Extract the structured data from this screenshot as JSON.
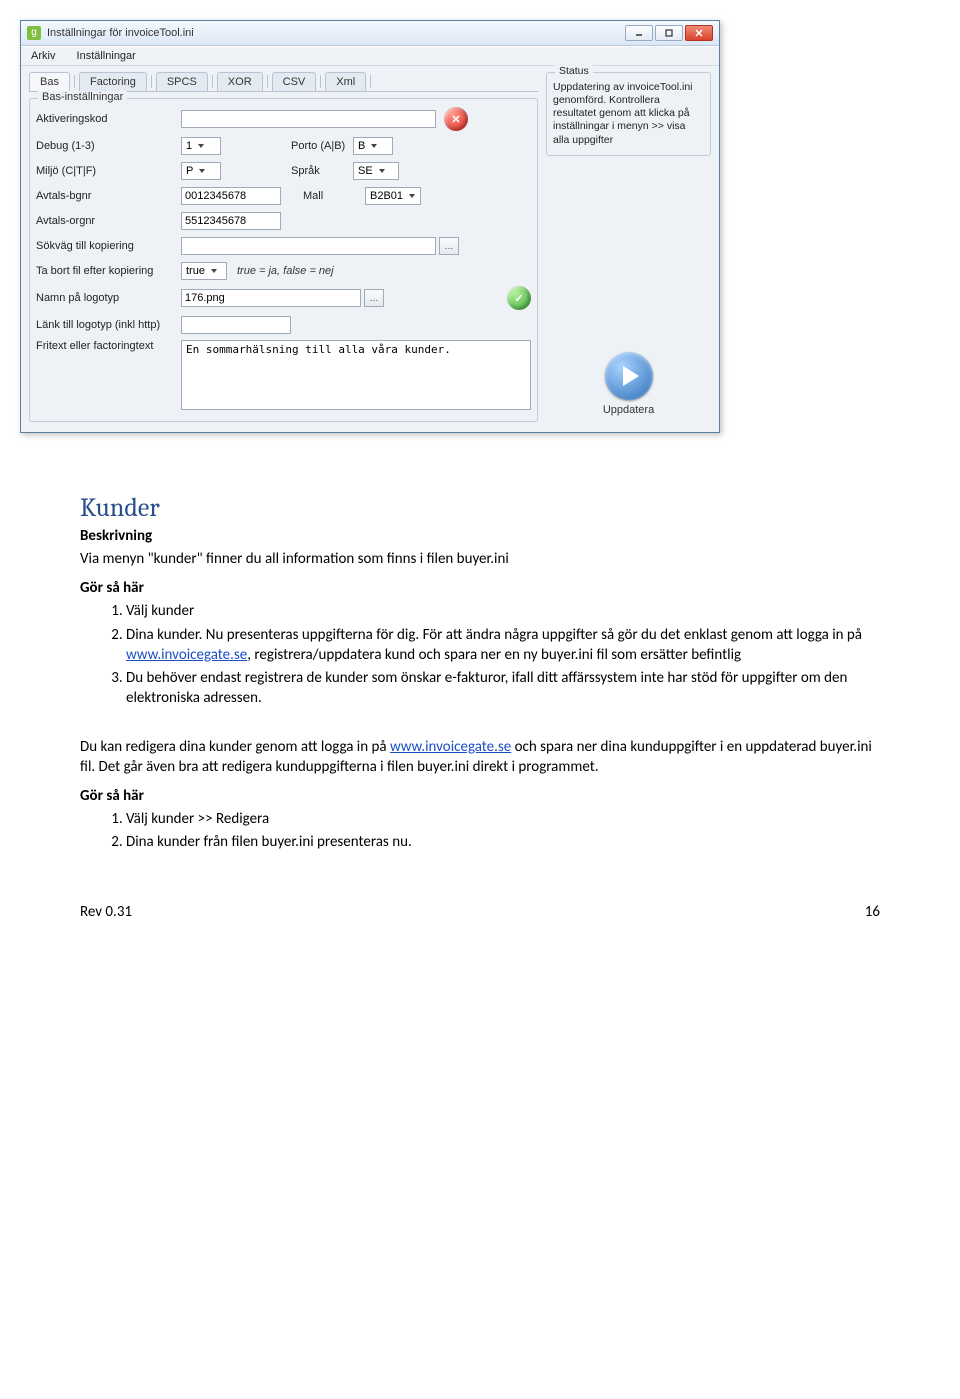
{
  "window": {
    "title": "Inställningar för invoiceTool.ini",
    "menu": [
      "Arkiv",
      "Inställningar"
    ],
    "tabs": [
      "Bas",
      "Factoring",
      "SPCS",
      "XOR",
      "CSV",
      "Xml"
    ],
    "group_label": "Bas-inställningar",
    "fields": {
      "aktiv_label": "Aktiveringskod",
      "aktiv_value": "",
      "debug_label": "Debug (1-3)",
      "debug_value": "1",
      "porto_label": "Porto (A|B)",
      "porto_value": "B",
      "miljo_label": "Miljö (C|T|F)",
      "miljo_value": "P",
      "sprak_label": "Språk",
      "sprak_value": "SE",
      "bgnr_label": "Avtals-bgnr",
      "bgnr_value": "0012345678",
      "mall_label": "Mall",
      "mall_value": "B2B01",
      "orgnr_label": "Avtals-orgnr",
      "orgnr_value": "5512345678",
      "sokvag_label": "Sökväg till kopiering",
      "sokvag_value": "",
      "tabort_label": "Ta bort fil efter kopiering",
      "tabort_value": "true",
      "tabort_help": "true = ja, false = nej",
      "logotyp_label": "Namn på logotyp",
      "logotyp_value": "176.png",
      "link_label": "Länk till logotyp (inkl http)",
      "link_value": "",
      "fritext_label": "Fritext eller factoringtext",
      "fritext_value": "En sommarhälsning till alla våra kunder."
    },
    "status": {
      "label": "Status",
      "text": "Uppdatering av invoiceTool.ini genomförd. Kontrollera resultatet genom att klicka på inställningar i menyn >> visa alla uppgifter"
    },
    "update_button": "Uppdatera"
  },
  "doc": {
    "heading": "Kunder",
    "sub1": "Beskrivning",
    "p1": "Via menyn \"kunder\" finner du all information som finns i filen buyer.ini",
    "sub2": "Gör så här",
    "list1": {
      "i1": "Välj kunder",
      "i2a": "Dina kunder. Nu presenteras uppgifterna för dig. För att ändra några uppgifter så gör du det enklast genom att logga in på ",
      "i2link": "www.invoicegate.se",
      "i2b": ", registrera/uppdatera kund och spara ner en ny buyer.ini fil som ersätter befintlig",
      "i3": "Du behöver endast registrera de kunder som önskar e-fakturor, ifall ditt affärssystem inte har stöd för uppgifter om den elektroniska adressen."
    },
    "p2a": "Du kan redigera dina kunder genom att logga in på ",
    "p2link": "www.invoicegate.se",
    "p2b": " och spara ner dina kunduppgifter i en uppdaterad buyer.ini fil. Det går även bra att redigera kunduppgifterna i filen buyer.ini direkt i programmet.",
    "sub3": "Gör så här",
    "list2": {
      "i1": "Välj kunder >> Redigera",
      "i2": "Dina kunder från filen buyer.ini presenteras nu."
    },
    "footer_left": "Rev 0.31",
    "footer_right": "16"
  }
}
